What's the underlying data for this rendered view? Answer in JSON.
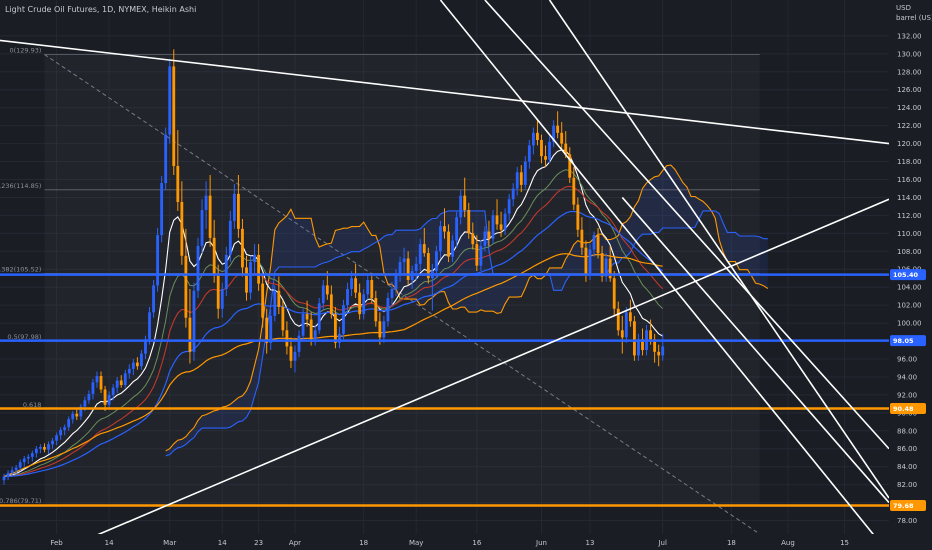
{
  "header": {
    "title": "Light Crude Oil Futures, 1D, NYMEX, Heikin Ashi",
    "currency": "USD",
    "unit": "barrel (US)"
  },
  "colors": {
    "background": "#1a1d24",
    "bull": "#2962ff",
    "bear": "#ff9800",
    "trendline": "#ffffff",
    "grid": "#242833",
    "fib": "#787b86"
  },
  "chart_data": {
    "type": "candlestick",
    "title": "Light Crude Oil Futures, 1D, NYMEX, Heikin Ashi",
    "ylabel": "barrel (US)",
    "ylim": [
      76.5,
      136
    ],
    "y_ticks": [
      78,
      80,
      82,
      84,
      86,
      88,
      90,
      92,
      94,
      96,
      98,
      100,
      102,
      104,
      106,
      108,
      110,
      112,
      114,
      116,
      118,
      120,
      122,
      124,
      126,
      128,
      130,
      132
    ],
    "x_ticks": [
      {
        "label": "Feb",
        "day": 0
      },
      {
        "label": "14",
        "day": 13
      },
      {
        "label": "Mar",
        "day": 28
      },
      {
        "label": "14",
        "day": 41
      },
      {
        "label": "23",
        "day": 50
      },
      {
        "label": "Apr",
        "day": 59
      },
      {
        "label": "18",
        "day": 76
      },
      {
        "label": "May",
        "day": 89
      },
      {
        "label": "16",
        "day": 104
      },
      {
        "label": "Jun",
        "day": 120
      },
      {
        "label": "13",
        "day": 132
      },
      {
        "label": "Jul",
        "day": 150
      },
      {
        "label": "18",
        "day": 167
      },
      {
        "label": "Aug",
        "day": 181
      },
      {
        "label": "15",
        "day": 195
      }
    ],
    "x_range": [
      -14,
      206
    ],
    "price_tags": [
      {
        "label": "105.40",
        "value": 105.4,
        "color": "#2962ff",
        "line": true
      },
      {
        "label": "98.05",
        "value": 98.05,
        "color": "#2962ff",
        "line": true
      },
      {
        "label": "90.48",
        "value": 90.48,
        "color": "#ff9800",
        "line": true
      },
      {
        "label": "79.68",
        "value": 79.68,
        "color": "#ff9800",
        "line": true
      }
    ],
    "fibonacci": [
      {
        "label": "0(129.93)",
        "value": 129.93
      },
      {
        "label": "0.236(114.85)",
        "value": 114.85
      },
      {
        "label": "0.382(105.52)",
        "value": 105.52
      },
      {
        "label": "0.5(97.98)",
        "value": 97.98
      },
      {
        "label": "0.618",
        "value": 90.44
      },
      {
        "label": "0.786(79.71)",
        "value": 79.71
      }
    ],
    "candles": [
      [
        -13,
        82.5,
        83.2,
        82.0,
        82.9
      ],
      [
        -12,
        82.9,
        83.6,
        82.5,
        83.3
      ],
      [
        -11,
        83.3,
        84.0,
        82.9,
        83.6
      ],
      [
        -10,
        83.6,
        84.2,
        83.1,
        83.9
      ],
      [
        -9,
        83.9,
        84.8,
        83.5,
        84.5
      ],
      [
        -8,
        84.5,
        85.2,
        84.0,
        84.9
      ],
      [
        -7,
        84.9,
        85.4,
        84.3,
        85.1
      ],
      [
        -6,
        85.1,
        85.8,
        84.6,
        85.5
      ],
      [
        -5,
        85.5,
        86.3,
        85.0,
        86.0
      ],
      [
        -4,
        86.0,
        86.5,
        85.5,
        86.2
      ],
      [
        -3,
        86.2,
        86.6,
        85.6,
        85.9
      ],
      [
        -2,
        85.9,
        86.8,
        85.4,
        86.5
      ],
      [
        -1,
        86.5,
        87.2,
        86.0,
        86.9
      ],
      [
        0,
        86.9,
        87.8,
        86.4,
        87.5
      ],
      [
        1,
        87.5,
        88.4,
        87.0,
        88.1
      ],
      [
        2,
        88.1,
        88.7,
        87.5,
        88.4
      ],
      [
        3,
        88.4,
        89.6,
        88.0,
        89.3
      ],
      [
        4,
        89.3,
        90.2,
        88.8,
        89.9
      ],
      [
        5,
        89.9,
        90.4,
        89.2,
        89.6
      ],
      [
        6,
        89.6,
        91.0,
        89.2,
        90.7
      ],
      [
        7,
        90.7,
        91.8,
        90.2,
        91.4
      ],
      [
        8,
        91.4,
        92.5,
        91.0,
        92.1
      ],
      [
        9,
        92.1,
        93.8,
        91.5,
        93.4
      ],
      [
        10,
        93.4,
        94.6,
        92.8,
        94.1
      ],
      [
        11,
        94.1,
        94.6,
        92.2,
        92.6
      ],
      [
        12,
        92.6,
        93.0,
        90.2,
        90.9
      ],
      [
        13,
        90.9,
        92.4,
        90.5,
        92.0
      ],
      [
        14,
        92.0,
        93.2,
        91.4,
        92.8
      ],
      [
        15,
        92.8,
        94.0,
        92.2,
        93.6
      ],
      [
        16,
        93.6,
        94.2,
        92.8,
        93.1
      ],
      [
        17,
        93.1,
        94.8,
        92.8,
        94.4
      ],
      [
        18,
        94.4,
        95.4,
        93.8,
        94.9
      ],
      [
        19,
        94.9,
        96.0,
        94.2,
        95.6
      ],
      [
        20,
        95.6,
        96.2,
        94.8,
        95.2
      ],
      [
        21,
        95.2,
        97.0,
        94.8,
        96.6
      ],
      [
        22,
        96.6,
        98.6,
        96.0,
        98.2
      ],
      [
        23,
        98.2,
        101.8,
        97.6,
        101.2
      ],
      [
        24,
        101.2,
        104.8,
        100.6,
        104.2
      ],
      [
        25,
        104.2,
        110.6,
        103.5,
        109.8
      ],
      [
        26,
        109.8,
        116.4,
        109.0,
        115.6
      ],
      [
        27,
        115.6,
        121.8,
        114.8,
        121.0
      ],
      [
        28,
        121.0,
        129.4,
        120.0,
        128.6
      ],
      [
        29,
        128.6,
        130.5,
        116.5,
        117.5
      ],
      [
        30,
        117.5,
        121.5,
        112.5,
        113.5
      ],
      [
        31,
        113.5,
        115.8,
        106.5,
        107.5
      ],
      [
        32,
        107.5,
        110.5,
        99.5,
        100.6
      ],
      [
        33,
        100.6,
        103.8,
        95.5,
        96.8
      ],
      [
        34,
        96.8,
        104.5,
        95.8,
        103.6
      ],
      [
        35,
        103.6,
        109.5,
        102.8,
        108.6
      ],
      [
        36,
        108.6,
        113.8,
        107.8,
        112.6
      ],
      [
        37,
        112.6,
        115.8,
        110.5,
        114.2
      ],
      [
        38,
        114.2,
        116.5,
        108.5,
        109.5
      ],
      [
        39,
        109.5,
        111.5,
        104.5,
        105.5
      ],
      [
        40,
        105.5,
        106.5,
        100.5,
        101.6
      ],
      [
        41,
        101.6,
        104.5,
        100.6,
        103.8
      ],
      [
        42,
        103.8,
        108.5,
        103.0,
        107.6
      ],
      [
        43,
        107.6,
        112.5,
        106.8,
        111.4
      ],
      [
        44,
        111.4,
        115.5,
        110.5,
        114.4
      ],
      [
        45,
        114.4,
        116.5,
        109.5,
        110.5
      ],
      [
        46,
        110.5,
        111.6,
        105.2,
        106.2
      ],
      [
        47,
        106.2,
        107.5,
        102.5,
        103.4
      ],
      [
        48,
        103.4,
        107.5,
        102.6,
        106.8
      ],
      [
        49,
        106.8,
        108.8,
        105.4,
        107.6
      ],
      [
        50,
        107.6,
        108.8,
        103.6,
        104.4
      ],
      [
        51,
        104.4,
        105.5,
        99.5,
        100.6
      ],
      [
        52,
        100.6,
        101.6,
        96.6,
        97.8
      ],
      [
        53,
        97.8,
        101.5,
        97.0,
        100.8
      ],
      [
        54,
        100.8,
        104.2,
        100.2,
        103.6
      ],
      [
        55,
        103.6,
        105.2,
        101.0,
        101.8
      ],
      [
        56,
        101.8,
        102.5,
        98.5,
        99.2
      ],
      [
        57,
        99.2,
        100.2,
        96.5,
        97.4
      ],
      [
        58,
        97.4,
        98.4,
        95.0,
        95.8
      ],
      [
        59,
        95.8,
        97.5,
        94.5,
        96.8
      ],
      [
        60,
        96.8,
        99.2,
        96.2,
        98.6
      ],
      [
        61,
        98.6,
        101.6,
        98.0,
        101.0
      ],
      [
        62,
        101.0,
        102.5,
        99.6,
        100.4
      ],
      [
        63,
        100.4,
        101.2,
        97.5,
        98.2
      ],
      [
        64,
        98.2,
        99.8,
        97.5,
        99.2
      ],
      [
        65,
        99.2,
        102.8,
        98.8,
        102.2
      ],
      [
        66,
        102.2,
        104.8,
        101.5,
        104.2
      ],
      [
        67,
        104.2,
        105.8,
        102.6,
        103.2
      ],
      [
        68,
        103.2,
        104.2,
        100.5,
        101.0
      ],
      [
        69,
        101.0,
        101.8,
        97.2,
        97.8
      ],
      [
        70,
        97.8,
        99.6,
        97.2,
        98.8
      ],
      [
        71,
        98.8,
        102.6,
        98.2,
        102.0
      ],
      [
        72,
        102.0,
        104.5,
        101.2,
        103.8
      ],
      [
        73,
        103.8,
        105.8,
        103.0,
        105.0
      ],
      [
        74,
        105.0,
        106.6,
        102.8,
        103.4
      ],
      [
        75,
        103.4,
        104.4,
        100.4,
        101.0
      ],
      [
        76,
        101.0,
        103.8,
        100.4,
        103.2
      ],
      [
        77,
        103.2,
        105.4,
        102.6,
        104.8
      ],
      [
        78,
        104.8,
        105.6,
        102.2,
        102.8
      ],
      [
        79,
        102.8,
        103.6,
        99.6,
        100.2
      ],
      [
        80,
        100.2,
        101.2,
        97.6,
        98.4
      ],
      [
        81,
        98.4,
        100.8,
        97.8,
        100.2
      ],
      [
        82,
        100.2,
        103.4,
        99.6,
        102.8
      ],
      [
        83,
        102.8,
        104.6,
        101.8,
        103.8
      ],
      [
        84,
        103.8,
        106.0,
        103.0,
        105.4
      ],
      [
        85,
        105.4,
        107.4,
        104.6,
        106.8
      ],
      [
        86,
        106.8,
        108.4,
        105.4,
        107.2
      ],
      [
        87,
        107.2,
        108.0,
        104.2,
        104.8
      ],
      [
        88,
        104.8,
        106.4,
        103.8,
        105.8
      ],
      [
        89,
        105.8,
        107.4,
        104.8,
        106.6
      ],
      [
        90,
        106.6,
        109.4,
        105.8,
        108.8
      ],
      [
        91,
        108.8,
        110.6,
        107.4,
        107.8
      ],
      [
        92,
        107.8,
        108.4,
        104.4,
        105.0
      ],
      [
        93,
        105.0,
        106.6,
        101.4,
        105.8
      ],
      [
        94,
        105.8,
        108.6,
        105.0,
        108.0
      ],
      [
        95,
        108.0,
        111.4,
        107.2,
        110.8
      ],
      [
        96,
        110.8,
        112.8,
        109.4,
        110.2
      ],
      [
        97,
        110.2,
        111.0,
        106.8,
        107.4
      ],
      [
        98,
        107.4,
        109.8,
        106.8,
        109.2
      ],
      [
        99,
        109.2,
        112.4,
        108.4,
        111.8
      ],
      [
        100,
        111.8,
        114.8,
        111.0,
        114.2
      ],
      [
        101,
        114.2,
        116.2,
        111.8,
        112.6
      ],
      [
        102,
        112.6,
        113.4,
        109.4,
        110.0
      ],
      [
        103,
        110.0,
        111.2,
        108.2,
        108.8
      ],
      [
        104,
        108.8,
        109.8,
        105.8,
        106.4
      ],
      [
        105,
        106.4,
        109.2,
        105.8,
        108.6
      ],
      [
        106,
        108.6,
        110.8,
        108.0,
        110.2
      ],
      [
        107,
        110.2,
        111.4,
        108.6,
        109.4
      ],
      [
        108,
        109.4,
        112.6,
        108.8,
        112.0
      ],
      [
        109,
        112.0,
        113.8,
        110.4,
        111.0
      ],
      [
        110,
        111.0,
        112.4,
        109.6,
        110.4
      ],
      [
        111,
        110.4,
        112.8,
        109.8,
        112.2
      ],
      [
        112,
        112.2,
        114.4,
        111.4,
        113.8
      ],
      [
        113,
        113.8,
        115.6,
        113.0,
        115.0
      ],
      [
        114,
        115.0,
        117.4,
        114.2,
        116.8
      ],
      [
        115,
        116.8,
        117.6,
        114.6,
        115.4
      ],
      [
        116,
        115.4,
        118.6,
        115.0,
        118.0
      ],
      [
        117,
        118.0,
        120.4,
        117.2,
        119.8
      ],
      [
        118,
        119.8,
        121.8,
        118.8,
        121.2
      ],
      [
        119,
        121.2,
        122.6,
        119.8,
        120.4
      ],
      [
        120,
        120.4,
        121.0,
        117.8,
        118.6
      ],
      [
        121,
        118.6,
        119.8,
        117.4,
        118.2
      ],
      [
        122,
        118.2,
        120.8,
        117.8,
        120.2
      ],
      [
        123,
        120.2,
        122.6,
        119.6,
        122.0
      ],
      [
        124,
        122.0,
        123.6,
        120.6,
        121.2
      ],
      [
        125,
        121.2,
        122.4,
        119.4,
        120.0
      ],
      [
        126,
        120.0,
        121.4,
        118.4,
        118.8
      ],
      [
        127,
        118.8,
        119.6,
        115.6,
        116.2
      ],
      [
        128,
        116.2,
        117.4,
        112.6,
        113.2
      ],
      [
        129,
        113.2,
        114.0,
        109.6,
        110.4
      ],
      [
        130,
        110.4,
        111.8,
        107.6,
        108.4
      ],
      [
        131,
        108.4,
        109.2,
        104.6,
        105.4
      ],
      [
        132,
        105.4,
        108.8,
        104.8,
        108.2
      ],
      [
        133,
        108.2,
        110.2,
        107.4,
        109.8
      ],
      [
        134,
        109.8,
        110.6,
        107.2,
        107.8
      ],
      [
        135,
        107.8,
        108.6,
        104.6,
        105.2
      ],
      [
        136,
        105.2,
        107.8,
        104.6,
        107.2
      ],
      [
        137,
        107.2,
        108.6,
        104.6,
        105.0
      ],
      [
        138,
        105.0,
        105.8,
        100.8,
        101.6
      ],
      [
        139,
        101.6,
        102.4,
        98.6,
        99.2
      ],
      [
        140,
        99.2,
        100.8,
        96.6,
        98.4
      ],
      [
        141,
        98.4,
        101.8,
        97.8,
        101.2
      ],
      [
        142,
        101.2,
        102.6,
        99.6,
        100.2
      ],
      [
        143,
        100.2,
        100.8,
        95.8,
        96.4
      ],
      [
        144,
        96.4,
        98.8,
        95.8,
        98.2
      ],
      [
        145,
        98.2,
        99.4,
        96.4,
        97.0
      ],
      [
        146,
        97.0,
        99.8,
        96.4,
        99.2
      ],
      [
        147,
        99.2,
        100.4,
        97.6,
        98.2
      ],
      [
        148,
        98.2,
        98.8,
        95.6,
        96.8
      ],
      [
        149,
        96.8,
        97.6,
        95.2,
        96.4
      ],
      [
        150,
        96.4,
        98.8,
        95.8,
        97.4
      ]
    ],
    "indicators": [
      {
        "name": "white",
        "color": "#ffffff"
      },
      {
        "name": "green",
        "color": "#6b8e5a"
      },
      {
        "name": "red",
        "color": "#c0392b"
      },
      {
        "name": "blue",
        "color": "#2962ff"
      },
      {
        "name": "orange",
        "color": "#ff9800"
      }
    ],
    "grid": true,
    "legend": "none"
  }
}
